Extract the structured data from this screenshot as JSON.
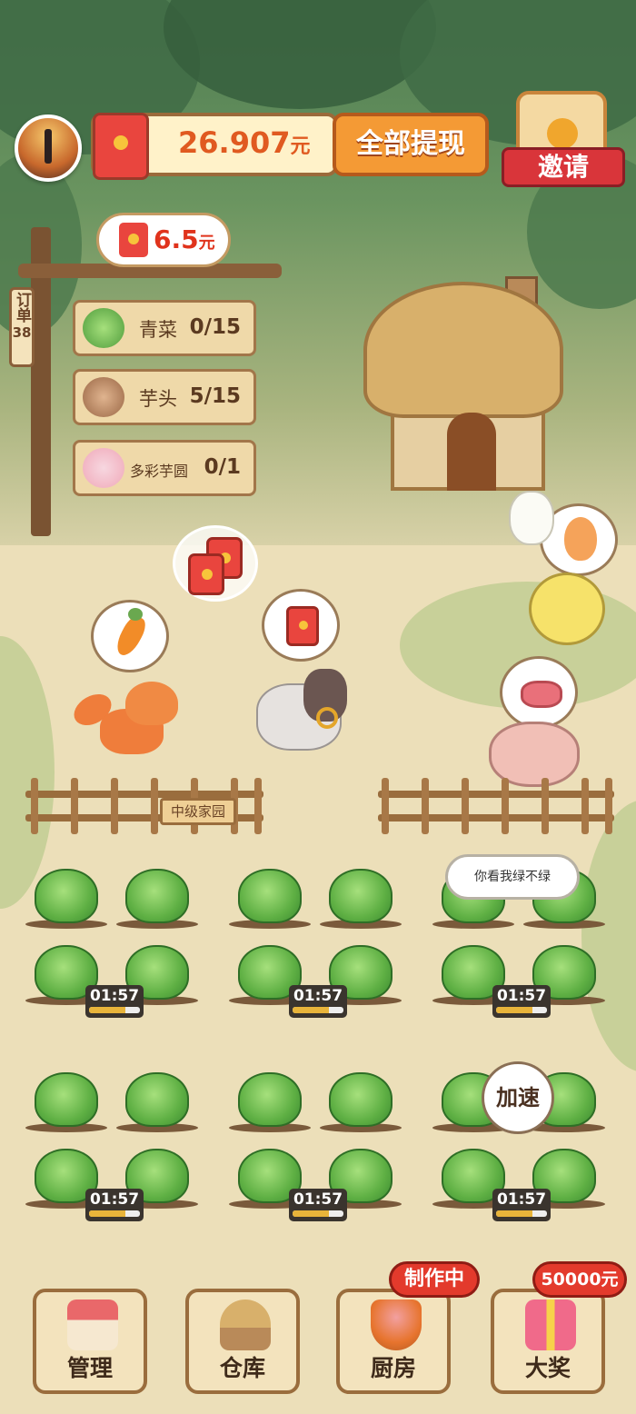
{
  "header": {
    "balance_amount": "26.907",
    "balance_unit": "元",
    "withdraw_label": "全部提现",
    "invite_label": "邀请"
  },
  "order_board": {
    "tag_label": "订单",
    "tag_number": "38",
    "reward_value": "6.5",
    "reward_unit": "元",
    "tasks": [
      {
        "name": "青菜",
        "progress": "0/15",
        "icon": "cabbage-icon"
      },
      {
        "name": "芋头",
        "progress": "5/15",
        "icon": "taro-icon"
      },
      {
        "name": "多彩芋圆",
        "progress": "0/1",
        "icon": "taro-ball-bowl-icon"
      }
    ]
  },
  "farm": {
    "fence_sign": "中级家园",
    "thought_bubble": "你看我绿不绿",
    "speedup_label": "加速",
    "timers": [
      "01:57",
      "01:57",
      "01:57",
      "01:57",
      "01:57",
      "01:57"
    ],
    "timer_progress": 0.72
  },
  "nav": {
    "items": [
      {
        "label": "管理",
        "icon": "house-icon"
      },
      {
        "label": "仓库",
        "icon": "hut-icon"
      },
      {
        "label": "厨房",
        "icon": "bowl-icon",
        "badge": "制作中"
      },
      {
        "label": "大奖",
        "icon": "gift-icon",
        "badge": "50000元"
      }
    ]
  },
  "colors": {
    "accent_orange": "#f49a35",
    "red_envelope": "#e9453e",
    "wood": "#9a6d3d"
  }
}
